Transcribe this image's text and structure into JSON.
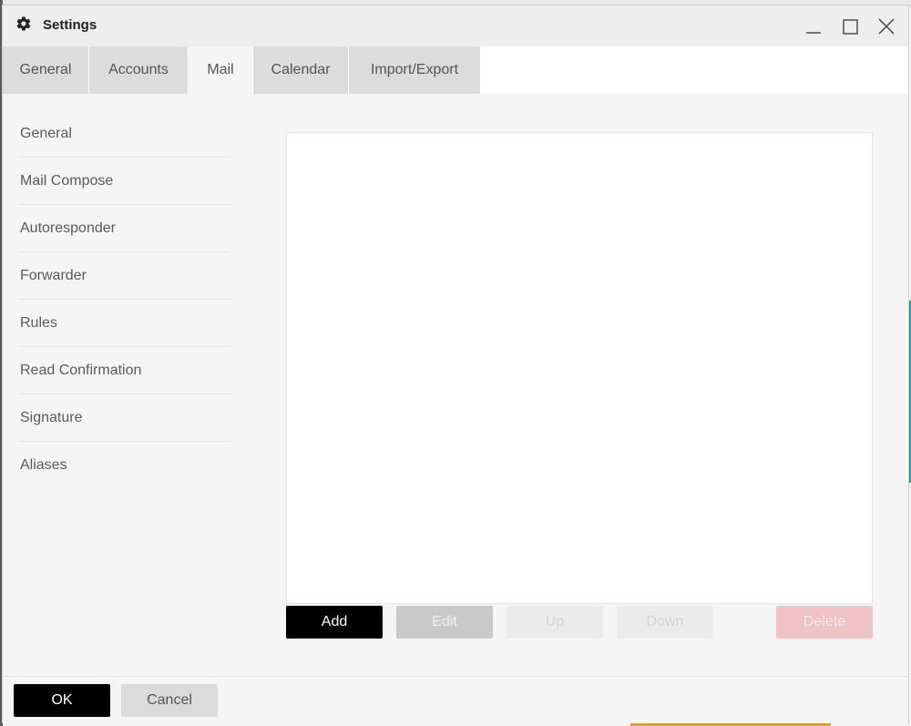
{
  "window": {
    "title": "Settings",
    "icon": "gear-icon"
  },
  "tabs": [
    {
      "label": "General"
    },
    {
      "label": "Accounts"
    },
    {
      "label": "Mail",
      "active": true
    },
    {
      "label": "Calendar"
    },
    {
      "label": "Import/Export"
    }
  ],
  "sidebar": {
    "items": [
      {
        "label": "General"
      },
      {
        "label": "Mail Compose"
      },
      {
        "label": "Autoresponder"
      },
      {
        "label": "Forwarder"
      },
      {
        "label": "Rules"
      },
      {
        "label": "Read Confirmation"
      },
      {
        "label": "Signature"
      },
      {
        "label": "Aliases"
      }
    ]
  },
  "actions": {
    "add": "Add",
    "edit": "Edit",
    "up": "Up",
    "down": "Down",
    "delete": "Delete"
  },
  "footer": {
    "ok": "OK",
    "cancel": "Cancel"
  },
  "colors": {
    "primary_button": "#000000",
    "delete_disabled": "#f0c3c3",
    "tab_inactive": "#dcdcdc"
  }
}
